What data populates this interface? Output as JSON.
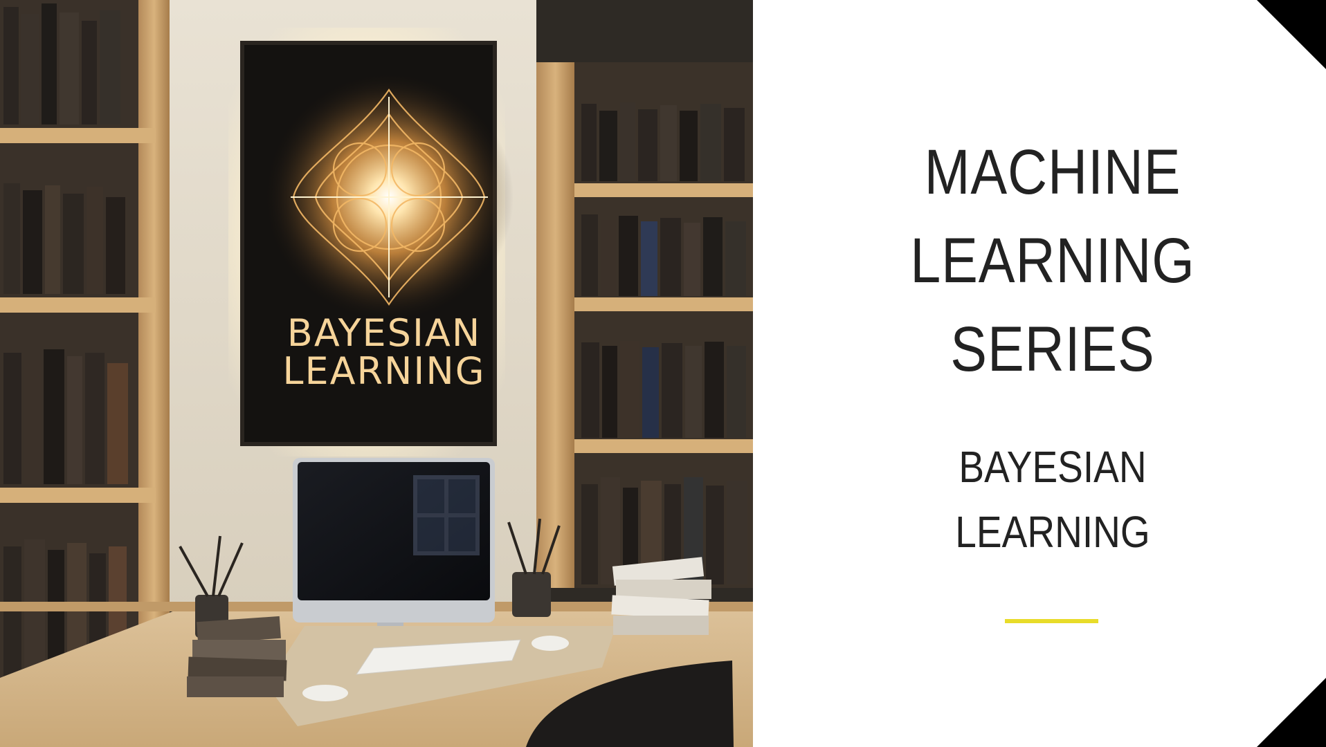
{
  "slide": {
    "title_lines": [
      "MACHINE",
      "LEARNING",
      "SERIES"
    ],
    "subtitle_lines": [
      "BAYESIAN",
      "LEARNING"
    ],
    "accent_color": "#e8dc2a",
    "text_color": "#222222",
    "background_color": "#ffffff"
  },
  "illustration": {
    "poster_lines": [
      "BAYESIAN",
      "LEARNING"
    ],
    "poster_glow_color": "#f5c06a"
  }
}
